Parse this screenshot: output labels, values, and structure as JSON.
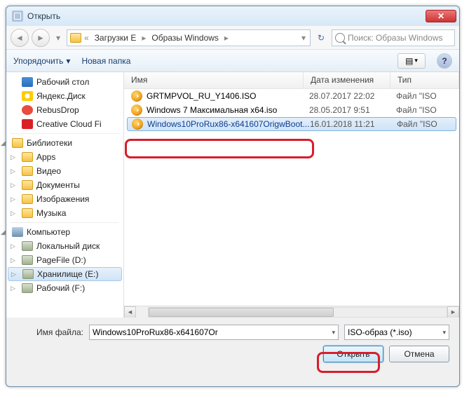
{
  "window": {
    "title": "Открыть"
  },
  "nav": {
    "crumb1_prefix": "«",
    "crumb1": "Загрузки E",
    "crumb2": "Образы Windows",
    "search_placeholder": "Поиск: Образы Windows"
  },
  "toolbar": {
    "organize": "Упорядочить",
    "newfolder": "Новая папка"
  },
  "tree": {
    "desktop": "Рабочий стол",
    "yandex": "Яндекс.Диск",
    "rebus": "RebusDrop",
    "adobe": "Creative Cloud Fi",
    "libraries": "Библиотеки",
    "apps": "Apps",
    "video": "Видео",
    "docs": "Документы",
    "images": "Изображения",
    "music": "Музыка",
    "computer": "Компьютер",
    "localdisk": "Локальный диск",
    "pagefile": "PageFile (D:)",
    "storage": "Хранилище (E:)",
    "work": "Рабочий (F:)"
  },
  "columns": {
    "name": "Имя",
    "date": "Дата изменения",
    "type": "Тип"
  },
  "files": [
    {
      "name": "GRTMPVOL_RU_Y1406.ISO",
      "date": "28.07.2017 22:02",
      "type": "Файл \"ISO"
    },
    {
      "name": "Windows 7 Максимальная x64.iso",
      "date": "28.05.2017 9:51",
      "type": "Файл \"ISO"
    },
    {
      "name": "Windows10ProRux86-x641607OrigwBoot...",
      "date": "16.01.2018 11:21",
      "type": "Файл \"ISO"
    }
  ],
  "footer": {
    "filename_label": "Имя файла:",
    "filename_value": "Windows10ProRux86-x641607Or",
    "filter": "ISO-образ (*.iso)",
    "open": "Открыть",
    "cancel": "Отмена"
  }
}
